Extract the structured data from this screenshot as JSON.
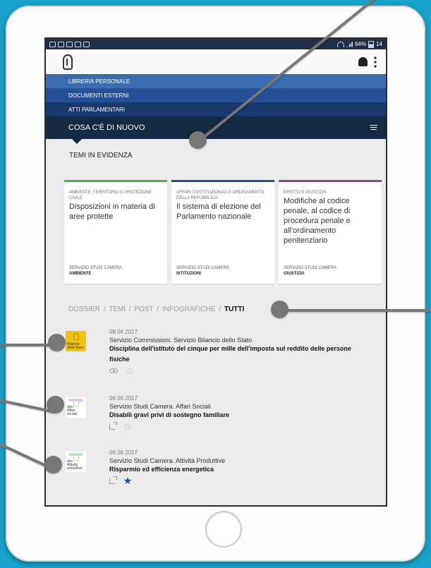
{
  "statusbar": {
    "battery": "64%",
    "time": "14"
  },
  "menu": {
    "items": [
      {
        "label": "LIBRERIA PERSONALE"
      },
      {
        "label": "DOCUMENTI ESTERNI"
      },
      {
        "label": "ATTI PARLAMENTARI"
      }
    ],
    "active": "COSA C'È DI NUOVO"
  },
  "section": {
    "title": "TEMI IN EVIDENZA"
  },
  "cards": [
    {
      "category": "AMBIENTE, TERRITORIO E PROTEZIONE CIVILE",
      "title": "Disposizioni in materia di aree protette",
      "service": "SERVIZIO STUDI CAMERA",
      "subject": "AMBIENTE",
      "accent": "#4caf50"
    },
    {
      "category": "AFFARI COSTITUZIONALI E ORDINAMENTO DELLA REPUBBLICA",
      "title": "Il sistema di elezione del Parlamento nazionale",
      "service": "SERVIZIO STUDI CAMERA",
      "subject": "ISTITUZIONI",
      "accent": "#294f86"
    },
    {
      "category": "DIRITTO E GIUSTIZIA",
      "title": "Modifiche al codice penale, al codice di procedura penale e all'ordinamento penitenziario",
      "service": "SERVIZIO STUDI CAMERA",
      "subject": "GIUSTIZIA",
      "accent": "#804a82"
    }
  ],
  "filters": {
    "dossier": "DOSSIER",
    "temi": "TEMI",
    "post": "POST",
    "infografiche": "INFOGRAFICHE",
    "tutti": "TUTTI",
    "separator": "/"
  },
  "feed": [
    {
      "thumb_text": "Bilancio dello Stato",
      "date": "08 06 2017",
      "source": "Servizio Commissioni. Servizio Bilancio dello Stato",
      "headline": "Disciplina dell'istituto del cinque per mille dell'imposta sul reddito delle persone fisiche",
      "star": "outline"
    },
    {
      "thumb_text_1": "doc.",
      "thumb_text_2": "Affari sociali",
      "date": "06 06 2017",
      "source": "Servizio Studi Camera. Affari Sociali",
      "headline": "Disabili gravi privi di sostegno familiare",
      "star": "outline",
      "accent": "#e6c6ed"
    },
    {
      "thumb_text_1": "doc.",
      "thumb_text_2": "Attività produttive",
      "date": "06 06 2017",
      "source": "Servizio Studi Camera. Attività Produttive",
      "headline": "Risparmio ed efficienza energetica",
      "star": "filled",
      "accent": "#bfe7bf"
    }
  ]
}
